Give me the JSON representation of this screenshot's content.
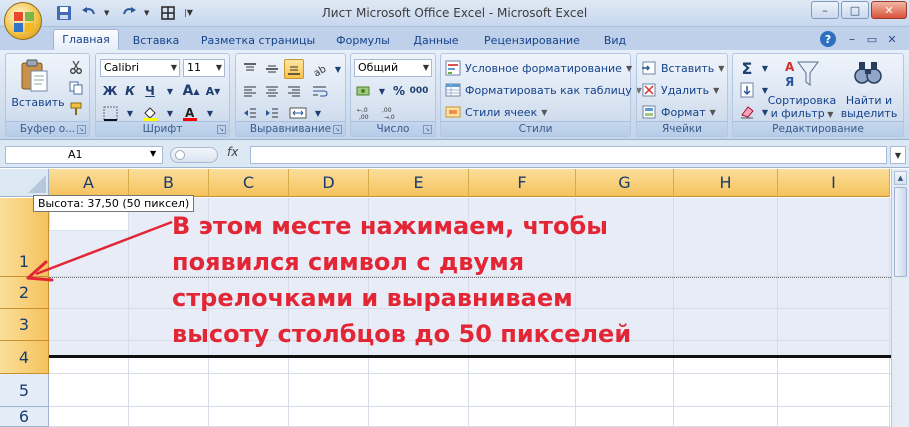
{
  "window": {
    "title": "Лист Microsoft Office Excel - Microsoft Excel",
    "controls": [
      "–",
      "□",
      "✕"
    ]
  },
  "tabs": [
    {
      "label": "Главная",
      "active": true
    },
    {
      "label": "Вставка"
    },
    {
      "label": "Разметка страницы"
    },
    {
      "label": "Формулы"
    },
    {
      "label": "Данные"
    },
    {
      "label": "Рецензирование"
    },
    {
      "label": "Вид"
    }
  ],
  "ribbon": {
    "clipboard": {
      "label": "Буфер о...",
      "paste": "Вставить"
    },
    "font": {
      "label": "Шрифт",
      "name": "Calibri",
      "size": "11",
      "bold": "Ж",
      "italic": "К",
      "underline": "Ч",
      "color_accent": "#ffff00",
      "font_color": "#ff0000"
    },
    "alignment": {
      "label": "Выравнивание"
    },
    "number": {
      "label": "Число",
      "format": "Общий",
      "percent": "%",
      "thousands": "000"
    },
    "styles": {
      "label": "Стили",
      "conditional": "Условное форматирование",
      "as_table": "Форматировать как таблицу",
      "cell_styles": "Стили ячеек"
    },
    "cells": {
      "label": "Ячейки",
      "insert": "Вставить",
      "delete": "Удалить",
      "format": "Формат"
    },
    "editing": {
      "label": "Редактирование",
      "sum": "Σ",
      "sort_line1": "Сортировка",
      "sort_line2": "и фильтр",
      "find_line1": "Найти и",
      "find_line2": "выделить"
    }
  },
  "formula_bar": {
    "name_box": "A1",
    "fx": "fx",
    "value": ""
  },
  "sheet": {
    "columns": [
      "A",
      "B",
      "C",
      "D",
      "E",
      "F",
      "G",
      "H",
      "I"
    ],
    "rows": [
      "1",
      "2",
      "3",
      "4",
      "5",
      "6"
    ],
    "tooltip": "Высота: 37,50 (50 пиксел)"
  },
  "annotation": {
    "lines": [
      "В этом месте нажимаем, чтобы",
      "появился символ с двумя",
      "стрелочками и выравниваем",
      "высоту столбцов до 50 пикселей"
    ],
    "color": "#e32636"
  }
}
